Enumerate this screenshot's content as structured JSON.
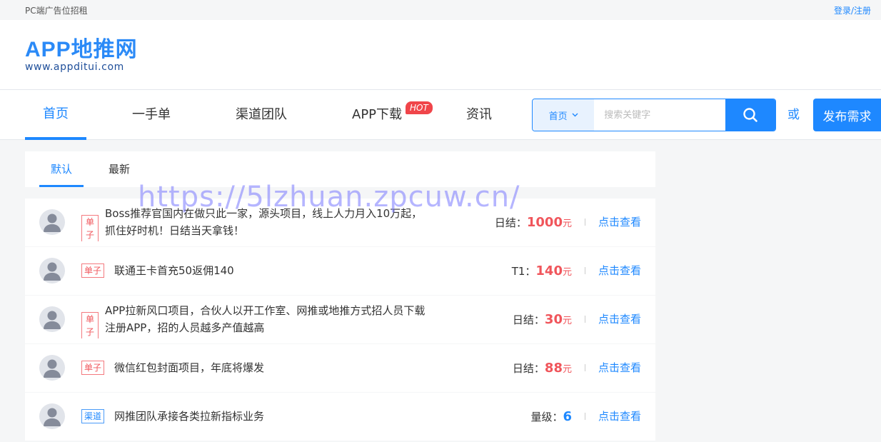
{
  "topbar": {
    "left": "PC端广告位招租",
    "right": "登录/注册"
  },
  "logo": {
    "main": "APP地推网",
    "sub": "www.appditui.com"
  },
  "nav": {
    "items": [
      "首页",
      "一手单",
      "渠道团队",
      "APP下载",
      "资讯"
    ],
    "hot_badge": "HOT",
    "active": 0
  },
  "search": {
    "scope": "首页",
    "placeholder": "搜索关键字",
    "value": ""
  },
  "or_label": "或",
  "publish_label": "发布需求",
  "tabs": [
    "默认",
    "最新"
  ],
  "list": [
    {
      "tag": "单子",
      "title": "Boss推荐官国内在做只此一家，源头项目，线上人力月入10万起，抓住好时机！日结当天拿钱！",
      "price_label": "日结：",
      "price": "1000",
      "unit": "元",
      "action": "点击查看"
    },
    {
      "tag": "单子",
      "title": "联通王卡首充50返佣140",
      "price_label": "T1：",
      "price": "140",
      "unit": "元",
      "action": "点击查看"
    },
    {
      "tag": "单子",
      "title": "APP拉新风口项目，合伙人以开工作室、网推或地推方式招人员下载注册APP，招的人员越多产值越高",
      "price_label": "日结：",
      "price": "30",
      "unit": "元",
      "action": "点击查看"
    },
    {
      "tag": "单子",
      "title": "微信红包封面项目，年底将爆发",
      "price_label": "日结：",
      "price": "88",
      "unit": "元",
      "action": "点击查看"
    },
    {
      "tag": "渠道",
      "title": "网推团队承接各类拉新指标业务",
      "price_label": "量级：",
      "price": "6",
      "unit": "",
      "action": "点击查看"
    }
  ],
  "watermark": "https://5lzhuan.zpcuw.cn/",
  "colors": {
    "accent": "#1e88ff",
    "price": "#f0555b",
    "hot": "#f0454a"
  }
}
